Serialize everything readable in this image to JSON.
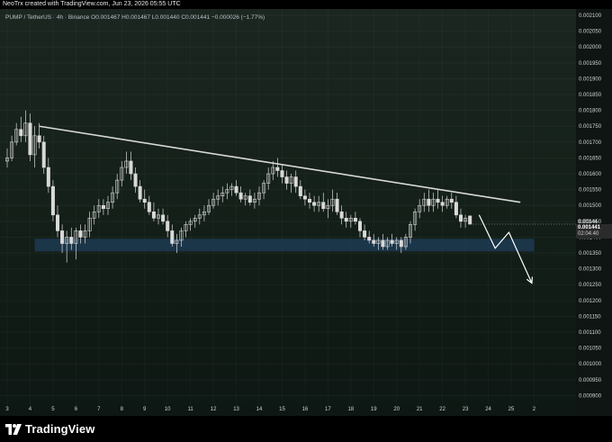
{
  "banner": {
    "text": "NeoTrx created with TradingView.com, Jun 23, 2026 05:55 UTC"
  },
  "legend": {
    "symbol": "PUMP / TetherUS · 4h · Binance",
    "open": "O0.001467",
    "high": "H0.001467",
    "low": "L0.001440",
    "close": "C0.001441",
    "change": "−0.000026 (−1.77%)"
  },
  "current_price": {
    "value": "0.001441",
    "countdown": "02:04:40",
    "hidden_label": "0.00144"
  },
  "footer": {
    "logo_text": "TradingView"
  },
  "colors": {
    "background": "#142019",
    "candle": "#d9d9d9",
    "trendline": "#d8d8d8",
    "support_zone": "#1d3a52",
    "arrow": "#ffffff"
  },
  "chart_data": {
    "type": "candlestick",
    "x_ticks": [
      "3",
      "4",
      "5",
      "6",
      "7",
      "8",
      "9",
      "10",
      "11",
      "12",
      "13",
      "14",
      "15",
      "16",
      "17",
      "18",
      "19",
      "20",
      "21",
      "22",
      "23",
      "24",
      "25",
      "2"
    ],
    "y_ticks": [
      "0.002100",
      "0.002050",
      "0.002000",
      "0.001950",
      "0.001900",
      "0.001850",
      "0.001800",
      "0.001750",
      "0.001700",
      "0.001650",
      "0.001600",
      "0.001550",
      "0.001500",
      "0.001450",
      "0.001400",
      "0.001350",
      "0.001300",
      "0.001250",
      "0.001200",
      "0.001150",
      "0.001100",
      "0.001050",
      "0.001000",
      "0.000950",
      "0.000900"
    ],
    "ylim": [
      0.00087,
      0.00212
    ],
    "xlim": [
      3.0,
      27.2
    ],
    "candles": [
      {
        "x": 3.0,
        "o": 0.00164,
        "h": 0.00168,
        "l": 0.00162,
        "c": 0.00165
      },
      {
        "x": 3.2,
        "o": 0.00165,
        "h": 0.00172,
        "l": 0.00164,
        "c": 0.0017
      },
      {
        "x": 3.4,
        "o": 0.0017,
        "h": 0.00176,
        "l": 0.00169,
        "c": 0.00174
      },
      {
        "x": 3.6,
        "o": 0.00174,
        "h": 0.00178,
        "l": 0.0017,
        "c": 0.00172
      },
      {
        "x": 3.8,
        "o": 0.00172,
        "h": 0.0018,
        "l": 0.0017,
        "c": 0.00176
      },
      {
        "x": 4.0,
        "o": 0.00176,
        "h": 0.00179,
        "l": 0.00164,
        "c": 0.00166
      },
      {
        "x": 4.2,
        "o": 0.00166,
        "h": 0.00175,
        "l": 0.00162,
        "c": 0.00172
      },
      {
        "x": 4.4,
        "o": 0.00172,
        "h": 0.00176,
        "l": 0.00168,
        "c": 0.0017
      },
      {
        "x": 4.6,
        "o": 0.0017,
        "h": 0.00172,
        "l": 0.0016,
        "c": 0.00162
      },
      {
        "x": 4.8,
        "o": 0.00162,
        "h": 0.00165,
        "l": 0.00154,
        "c": 0.00156
      },
      {
        "x": 5.0,
        "o": 0.00156,
        "h": 0.00158,
        "l": 0.00145,
        "c": 0.00147
      },
      {
        "x": 5.2,
        "o": 0.00147,
        "h": 0.0015,
        "l": 0.0014,
        "c": 0.00142
      },
      {
        "x": 5.4,
        "o": 0.00142,
        "h": 0.00144,
        "l": 0.00135,
        "c": 0.00138
      },
      {
        "x": 5.6,
        "o": 0.00138,
        "h": 0.00142,
        "l": 0.00132,
        "c": 0.0014
      },
      {
        "x": 5.8,
        "o": 0.0014,
        "h": 0.00143,
        "l": 0.00136,
        "c": 0.00138
      },
      {
        "x": 6.0,
        "o": 0.00138,
        "h": 0.00143,
        "l": 0.00133,
        "c": 0.00142
      },
      {
        "x": 6.2,
        "o": 0.00142,
        "h": 0.00144,
        "l": 0.00138,
        "c": 0.0014
      },
      {
        "x": 6.4,
        "o": 0.0014,
        "h": 0.00144,
        "l": 0.00138,
        "c": 0.00142
      },
      {
        "x": 6.6,
        "o": 0.00142,
        "h": 0.00148,
        "l": 0.0014,
        "c": 0.00146
      },
      {
        "x": 6.8,
        "o": 0.00146,
        "h": 0.0015,
        "l": 0.00144,
        "c": 0.00148
      },
      {
        "x": 7.0,
        "o": 0.00148,
        "h": 0.00152,
        "l": 0.00146,
        "c": 0.0015
      },
      {
        "x": 7.2,
        "o": 0.0015,
        "h": 0.00152,
        "l": 0.00147,
        "c": 0.00149
      },
      {
        "x": 7.4,
        "o": 0.00149,
        "h": 0.00153,
        "l": 0.00147,
        "c": 0.00151
      },
      {
        "x": 7.6,
        "o": 0.00151,
        "h": 0.00156,
        "l": 0.00149,
        "c": 0.00154
      },
      {
        "x": 7.8,
        "o": 0.00154,
        "h": 0.0016,
        "l": 0.00152,
        "c": 0.00158
      },
      {
        "x": 8.0,
        "o": 0.00158,
        "h": 0.00164,
        "l": 0.00156,
        "c": 0.00162
      },
      {
        "x": 8.2,
        "o": 0.00162,
        "h": 0.00167,
        "l": 0.0016,
        "c": 0.00164
      },
      {
        "x": 8.4,
        "o": 0.00164,
        "h": 0.00167,
        "l": 0.00158,
        "c": 0.0016
      },
      {
        "x": 8.6,
        "o": 0.0016,
        "h": 0.00162,
        "l": 0.00154,
        "c": 0.00156
      },
      {
        "x": 8.8,
        "o": 0.00156,
        "h": 0.00158,
        "l": 0.00151,
        "c": 0.00152
      },
      {
        "x": 9.0,
        "o": 0.00152,
        "h": 0.00155,
        "l": 0.00149,
        "c": 0.00151
      },
      {
        "x": 9.2,
        "o": 0.00151,
        "h": 0.00153,
        "l": 0.00147,
        "c": 0.00148
      },
      {
        "x": 9.4,
        "o": 0.00148,
        "h": 0.00151,
        "l": 0.00145,
        "c": 0.00146
      },
      {
        "x": 9.6,
        "o": 0.00146,
        "h": 0.00149,
        "l": 0.00144,
        "c": 0.00147
      },
      {
        "x": 9.8,
        "o": 0.00147,
        "h": 0.00149,
        "l": 0.00144,
        "c": 0.00145
      },
      {
        "x": 10.0,
        "o": 0.00145,
        "h": 0.00147,
        "l": 0.0014,
        "c": 0.00142
      },
      {
        "x": 10.2,
        "o": 0.00142,
        "h": 0.00144,
        "l": 0.00137,
        "c": 0.00138
      },
      {
        "x": 10.4,
        "o": 0.00138,
        "h": 0.00141,
        "l": 0.00135,
        "c": 0.00139
      },
      {
        "x": 10.6,
        "o": 0.00139,
        "h": 0.00143,
        "l": 0.00137,
        "c": 0.00142
      },
      {
        "x": 10.8,
        "o": 0.00142,
        "h": 0.00145,
        "l": 0.0014,
        "c": 0.00144
      },
      {
        "x": 11.0,
        "o": 0.00144,
        "h": 0.00146,
        "l": 0.00142,
        "c": 0.00145
      },
      {
        "x": 11.2,
        "o": 0.00145,
        "h": 0.00147,
        "l": 0.00143,
        "c": 0.00146
      },
      {
        "x": 11.4,
        "o": 0.00146,
        "h": 0.00149,
        "l": 0.00144,
        "c": 0.00147
      },
      {
        "x": 11.6,
        "o": 0.00147,
        "h": 0.0015,
        "l": 0.00145,
        "c": 0.00148
      },
      {
        "x": 11.8,
        "o": 0.00148,
        "h": 0.00152,
        "l": 0.00147,
        "c": 0.0015
      },
      {
        "x": 12.0,
        "o": 0.0015,
        "h": 0.00154,
        "l": 0.00149,
        "c": 0.00152
      },
      {
        "x": 12.2,
        "o": 0.00152,
        "h": 0.00155,
        "l": 0.0015,
        "c": 0.00153
      },
      {
        "x": 12.4,
        "o": 0.00153,
        "h": 0.00156,
        "l": 0.00151,
        "c": 0.00154
      },
      {
        "x": 12.6,
        "o": 0.00154,
        "h": 0.00157,
        "l": 0.00152,
        "c": 0.00155
      },
      {
        "x": 12.8,
        "o": 0.00155,
        "h": 0.00157,
        "l": 0.00153,
        "c": 0.00156
      },
      {
        "x": 13.0,
        "o": 0.00156,
        "h": 0.00158,
        "l": 0.00153,
        "c": 0.00154
      },
      {
        "x": 13.2,
        "o": 0.00154,
        "h": 0.00156,
        "l": 0.00151,
        "c": 0.00152
      },
      {
        "x": 13.4,
        "o": 0.00152,
        "h": 0.00154,
        "l": 0.0015,
        "c": 0.00153
      },
      {
        "x": 13.6,
        "o": 0.00153,
        "h": 0.00155,
        "l": 0.0015,
        "c": 0.00151
      },
      {
        "x": 13.8,
        "o": 0.00151,
        "h": 0.00154,
        "l": 0.00149,
        "c": 0.00152
      },
      {
        "x": 14.0,
        "o": 0.00152,
        "h": 0.00156,
        "l": 0.0015,
        "c": 0.00154
      },
      {
        "x": 14.2,
        "o": 0.00154,
        "h": 0.00158,
        "l": 0.00152,
        "c": 0.00157
      },
      {
        "x": 14.4,
        "o": 0.00157,
        "h": 0.00162,
        "l": 0.00155,
        "c": 0.0016
      },
      {
        "x": 14.6,
        "o": 0.0016,
        "h": 0.00164,
        "l": 0.00158,
        "c": 0.00162
      },
      {
        "x": 14.8,
        "o": 0.00162,
        "h": 0.00165,
        "l": 0.00159,
        "c": 0.00161
      },
      {
        "x": 15.0,
        "o": 0.00161,
        "h": 0.00163,
        "l": 0.00157,
        "c": 0.00159
      },
      {
        "x": 15.2,
        "o": 0.00159,
        "h": 0.00161,
        "l": 0.00155,
        "c": 0.00157
      },
      {
        "x": 15.4,
        "o": 0.00157,
        "h": 0.0016,
        "l": 0.00154,
        "c": 0.00159
      },
      {
        "x": 15.6,
        "o": 0.00159,
        "h": 0.00161,
        "l": 0.00154,
        "c": 0.00156
      },
      {
        "x": 15.8,
        "o": 0.00156,
        "h": 0.00158,
        "l": 0.00152,
        "c": 0.00153
      },
      {
        "x": 16.0,
        "o": 0.00153,
        "h": 0.00155,
        "l": 0.0015,
        "c": 0.00152
      },
      {
        "x": 16.2,
        "o": 0.00152,
        "h": 0.00154,
        "l": 0.00149,
        "c": 0.00151
      },
      {
        "x": 16.4,
        "o": 0.00151,
        "h": 0.00153,
        "l": 0.00148,
        "c": 0.0015
      },
      {
        "x": 16.6,
        "o": 0.0015,
        "h": 0.00153,
        "l": 0.00148,
        "c": 0.00151
      },
      {
        "x": 16.8,
        "o": 0.00151,
        "h": 0.00154,
        "l": 0.00148,
        "c": 0.00149
      },
      {
        "x": 17.0,
        "o": 0.00149,
        "h": 0.00152,
        "l": 0.00146,
        "c": 0.0015
      },
      {
        "x": 17.2,
        "o": 0.0015,
        "h": 0.00155,
        "l": 0.00148,
        "c": 0.00152
      },
      {
        "x": 17.4,
        "o": 0.00152,
        "h": 0.00154,
        "l": 0.00147,
        "c": 0.00148
      },
      {
        "x": 17.6,
        "o": 0.00148,
        "h": 0.0015,
        "l": 0.00144,
        "c": 0.00146
      },
      {
        "x": 17.8,
        "o": 0.00146,
        "h": 0.00148,
        "l": 0.00143,
        "c": 0.00145
      },
      {
        "x": 18.0,
        "o": 0.00145,
        "h": 0.00147,
        "l": 0.00143,
        "c": 0.00146
      },
      {
        "x": 18.2,
        "o": 0.00146,
        "h": 0.00148,
        "l": 0.00144,
        "c": 0.00145
      },
      {
        "x": 18.4,
        "o": 0.00145,
        "h": 0.00146,
        "l": 0.0014,
        "c": 0.00142
      },
      {
        "x": 18.6,
        "o": 0.00142,
        "h": 0.00144,
        "l": 0.00139,
        "c": 0.0014
      },
      {
        "x": 18.8,
        "o": 0.0014,
        "h": 0.00142,
        "l": 0.00138,
        "c": 0.00139
      },
      {
        "x": 19.0,
        "o": 0.00139,
        "h": 0.00141,
        "l": 0.00137,
        "c": 0.00138
      },
      {
        "x": 19.2,
        "o": 0.00138,
        "h": 0.0014,
        "l": 0.00136,
        "c": 0.00139
      },
      {
        "x": 19.4,
        "o": 0.00139,
        "h": 0.00141,
        "l": 0.00136,
        "c": 0.00137
      },
      {
        "x": 19.6,
        "o": 0.00137,
        "h": 0.0014,
        "l": 0.00136,
        "c": 0.00139
      },
      {
        "x": 19.8,
        "o": 0.00139,
        "h": 0.00141,
        "l": 0.00137,
        "c": 0.00138
      },
      {
        "x": 20.0,
        "o": 0.00138,
        "h": 0.0014,
        "l": 0.00136,
        "c": 0.00139
      },
      {
        "x": 20.2,
        "o": 0.00139,
        "h": 0.0014,
        "l": 0.00135,
        "c": 0.00137
      },
      {
        "x": 20.4,
        "o": 0.00137,
        "h": 0.00141,
        "l": 0.00136,
        "c": 0.0014
      },
      {
        "x": 20.6,
        "o": 0.0014,
        "h": 0.00145,
        "l": 0.00138,
        "c": 0.00144
      },
      {
        "x": 20.8,
        "o": 0.00144,
        "h": 0.00149,
        "l": 0.00142,
        "c": 0.00148
      },
      {
        "x": 21.0,
        "o": 0.00148,
        "h": 0.00152,
        "l": 0.00146,
        "c": 0.0015
      },
      {
        "x": 21.2,
        "o": 0.0015,
        "h": 0.00154,
        "l": 0.00148,
        "c": 0.00152
      },
      {
        "x": 21.4,
        "o": 0.00152,
        "h": 0.00155,
        "l": 0.00148,
        "c": 0.0015
      },
      {
        "x": 21.6,
        "o": 0.0015,
        "h": 0.00154,
        "l": 0.00148,
        "c": 0.00152
      },
      {
        "x": 21.8,
        "o": 0.00152,
        "h": 0.00155,
        "l": 0.00149,
        "c": 0.00151
      },
      {
        "x": 22.0,
        "o": 0.00151,
        "h": 0.00153,
        "l": 0.00148,
        "c": 0.0015
      },
      {
        "x": 22.2,
        "o": 0.0015,
        "h": 0.00153,
        "l": 0.00149,
        "c": 0.00152
      },
      {
        "x": 22.4,
        "o": 0.00152,
        "h": 0.00154,
        "l": 0.00149,
        "c": 0.00151
      },
      {
        "x": 22.6,
        "o": 0.00151,
        "h": 0.00153,
        "l": 0.00146,
        "c": 0.00147
      },
      {
        "x": 22.8,
        "o": 0.00147,
        "h": 0.00149,
        "l": 0.00143,
        "c": 0.00145
      },
      {
        "x": 23.0,
        "o": 0.00145,
        "h": 0.00147,
        "l": 0.00143,
        "c": 0.00146
      },
      {
        "x": 23.2,
        "o": 0.001467,
        "h": 0.001467,
        "l": 0.00144,
        "c": 0.001441
      }
    ],
    "trendline": [
      {
        "x": 4.4,
        "y": 0.00175
      },
      {
        "x": 25.4,
        "y": 0.00151
      }
    ],
    "support_zone": {
      "x_from": 4.2,
      "x_to": 26.0,
      "y_low": 0.001355,
      "y_high": 0.001395
    },
    "projection": [
      {
        "x": 23.6,
        "y": 0.00147
      },
      {
        "x": 24.3,
        "y": 0.001365
      },
      {
        "x": 24.9,
        "y": 0.001415
      },
      {
        "x": 25.9,
        "y": 0.001255
      }
    ]
  }
}
